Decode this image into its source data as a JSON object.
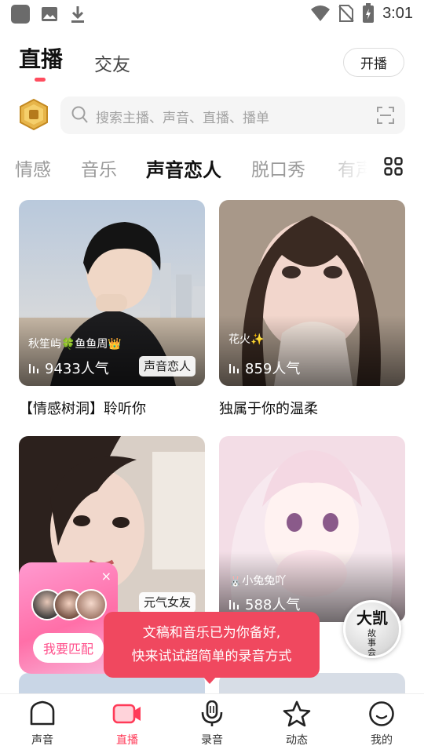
{
  "status_bar": {
    "time": "3:01"
  },
  "header": {
    "tabs": [
      {
        "label": "直播",
        "active": true
      },
      {
        "label": "交友",
        "active": false
      }
    ],
    "start_button": "开播"
  },
  "search": {
    "placeholder": "搜索主播、声音、直播、播单"
  },
  "categories": [
    {
      "label": "情感",
      "active": false
    },
    {
      "label": "音乐",
      "active": false
    },
    {
      "label": "声音恋人",
      "active": true
    },
    {
      "label": "脱口秀",
      "active": false
    },
    {
      "label": "有声",
      "active": false
    }
  ],
  "cards": [
    {
      "host": "秋笙屿🍀鱼鱼周👑",
      "popularity": "9433人气",
      "tag": "声音恋人",
      "title": "【情感树洞】聆听你"
    },
    {
      "host": "花火✨",
      "popularity": "859人气",
      "tag": "",
      "title": "独属于你的温柔"
    },
    {
      "host": "",
      "popularity": "",
      "tag": "元气女友",
      "title": ""
    },
    {
      "host": "🐰小兔兔吖",
      "popularity": "588人气",
      "tag": "",
      "title": ""
    }
  ],
  "match_popup": {
    "button": "我要匹配",
    "close": "×"
  },
  "tooltip": {
    "line1": "文稿和音乐已为你备好,",
    "line2": "快来试试超简单的录音方式"
  },
  "float_badge": {
    "big": "大凯",
    "small": "故事会"
  },
  "bottom_nav": [
    {
      "label": "声音",
      "icon": "sound-icon",
      "active": false
    },
    {
      "label": "直播",
      "icon": "live-camera-icon",
      "active": true
    },
    {
      "label": "录音",
      "icon": "microphone-icon",
      "active": false
    },
    {
      "label": "动态",
      "icon": "star-icon",
      "active": false
    },
    {
      "label": "我的",
      "icon": "profile-icon",
      "active": false
    }
  ],
  "colors": {
    "accent": "#ff3b58",
    "tooltip": "#f0485f"
  }
}
